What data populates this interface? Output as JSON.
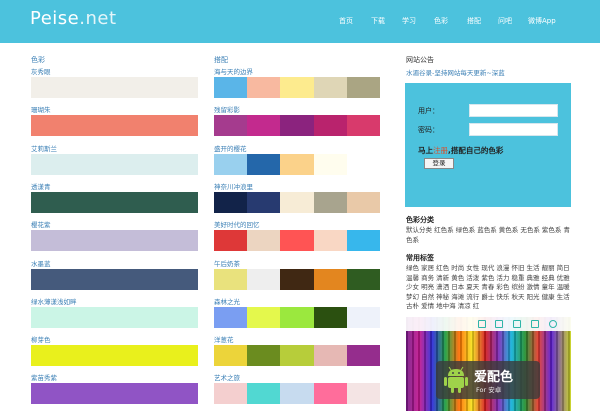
{
  "header": {
    "logo_main": "Peise",
    "logo_suffix": ".net",
    "nav": [
      "首页",
      "下载",
      "学习",
      "色彩",
      "搭配",
      "问吧",
      "微博App"
    ]
  },
  "colors_section": {
    "title": "色彩",
    "items": [
      {
        "label": "灰秀眼",
        "color": "#f2efe9"
      },
      {
        "label": "珊瑚朱",
        "color": "#f1816e"
      },
      {
        "label": "艾莉斯兰",
        "color": "#dceeee"
      },
      {
        "label": "透漾青",
        "color": "#2f5d4f"
      },
      {
        "label": "樱花紫",
        "color": "#c4bdd8"
      },
      {
        "label": "水墨蓝",
        "color": "#455a7c"
      },
      {
        "label": "绿水薄漾浅如畔",
        "color": "#cbf5e6"
      },
      {
        "label": "柳芽色",
        "color": "#e9f01c"
      },
      {
        "label": "紫苗秀紫",
        "color": "#9054c5"
      }
    ]
  },
  "schemes_section": {
    "title": "搭配",
    "items": [
      {
        "label": "海与天的边界",
        "colors": [
          "#5ab5e8",
          "#f8b9a0",
          "#fdeb8e",
          "#dfd6b6",
          "#aaa583"
        ]
      },
      {
        "label": "残留彩影",
        "colors": [
          "#a53b8e",
          "#c32a8e",
          "#8b237e",
          "#b9236d",
          "#d83a6c"
        ]
      },
      {
        "label": "盛开的樱花",
        "colors": [
          "#99d0ee",
          "#2467aa",
          "#fbd28a",
          "#fffdee",
          "#ffffff"
        ]
      },
      {
        "label": "神奈川冲浪里",
        "colors": [
          "#122349",
          "#273a70",
          "#f7ecd6",
          "#a8a48e",
          "#e9c9a8"
        ]
      },
      {
        "label": "美好时代的回忆",
        "colors": [
          "#de3838",
          "#ecd5c1",
          "#ff5454",
          "#f9d7c4",
          "#37b7ec"
        ]
      },
      {
        "label": "午后奶茶",
        "colors": [
          "#e9e27d",
          "#eeeeee",
          "#402813",
          "#e3861f",
          "#2f5c21"
        ]
      },
      {
        "label": "森林之光",
        "colors": [
          "#7a9ef2",
          "#e4f84c",
          "#9be83e",
          "#2b5010",
          "#eef2fa"
        ]
      },
      {
        "label": "洋葱花",
        "colors": [
          "#ecd43a",
          "#6b8c1f",
          "#b7cd3a",
          "#e6b8b4",
          "#952d8d"
        ]
      },
      {
        "label": "艺术之旅",
        "colors": [
          "#f4cfcf",
          "#51d8d2",
          "#c7dbef",
          "#ff6d9b",
          "#f4e4e4"
        ]
      }
    ]
  },
  "sidebar": {
    "announce_title": "网站公告",
    "announce_link": "水湄谷录-坚持网站每天更新~深蓝",
    "login": {
      "user_label": "用户：",
      "pass_label": "密码：",
      "tagline_prefix": "马上",
      "tagline_register": "注册",
      "tagline_suffix": ",搭配自己的色彩",
      "button": "登录"
    },
    "categories_title": "色彩分类",
    "categories_text": "默认分类 红色系 绿色系 蓝色系 黄色系 无色系 紫色系 青色系",
    "tags_title": "常用标签",
    "tags_text": "绿色 家居 红色 时尚 女性 现代 浪漫 怀旧 生活 靓丽 简日 温馨 商务 清新 黄色 活泼 紫色 活力 稳重 典雅 经典 优雅 少女 明亮 潇洒 日本 夏天 青春 彩色 缤纷 激情 童年 温暖 梦幻 自然 神秘 海滩 流行 爵士 快乐 秋天 阳光 健康 生活 古朴 爱情 地中海 清凉 红"
  },
  "promo": {
    "title": "爱配色",
    "subtitle": "For 安卓",
    "toolbar_icons": [
      "save-icon",
      "scan-icon",
      "expand-icon",
      "share-icon",
      "settings-icon"
    ]
  }
}
